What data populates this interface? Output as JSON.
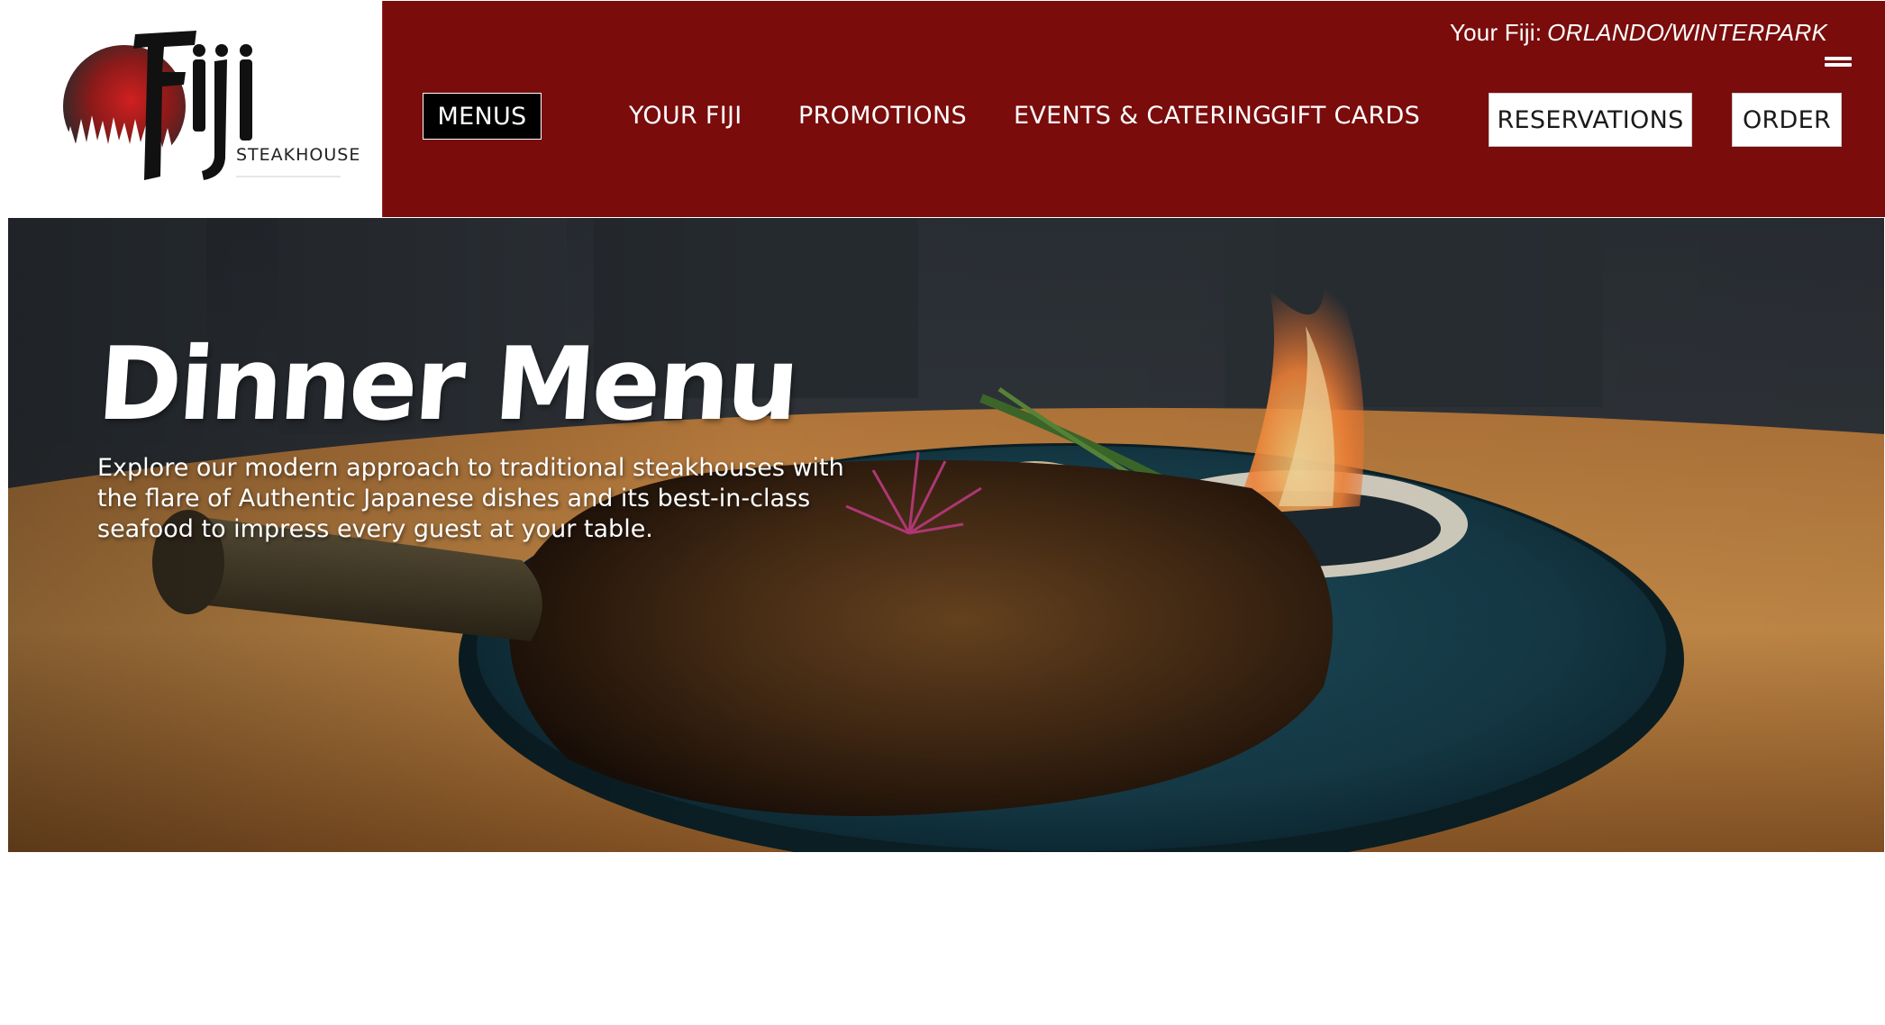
{
  "logo": {
    "brand": "Fiji",
    "tagline": "STEAKHOUSE"
  },
  "location": {
    "prefix": "Your Fiji:",
    "city": "ORLANDO/WINTERPARK"
  },
  "nav": {
    "items": [
      {
        "label": "MENUS",
        "active": true
      },
      {
        "label": "YOUR FIJI"
      },
      {
        "label": "PROMOTIONS"
      },
      {
        "label": "EVENTS & CATERING"
      },
      {
        "label": "GIFT CARDS"
      }
    ],
    "reservations_label": "RESERVATIONS",
    "order_label": "ORDER"
  },
  "hero": {
    "title": "Dinner Menu",
    "description": "Explore our modern approach to traditional steakhouses with the flare of Authentic Japanese dishes and its best-in-class seafood to impress every guest at your table."
  },
  "colors": {
    "brand_red": "#7a0c0c",
    "active_nav": "#000000",
    "button_bg": "#ffffff"
  },
  "icons": {
    "menu": "hamburger-icon"
  }
}
